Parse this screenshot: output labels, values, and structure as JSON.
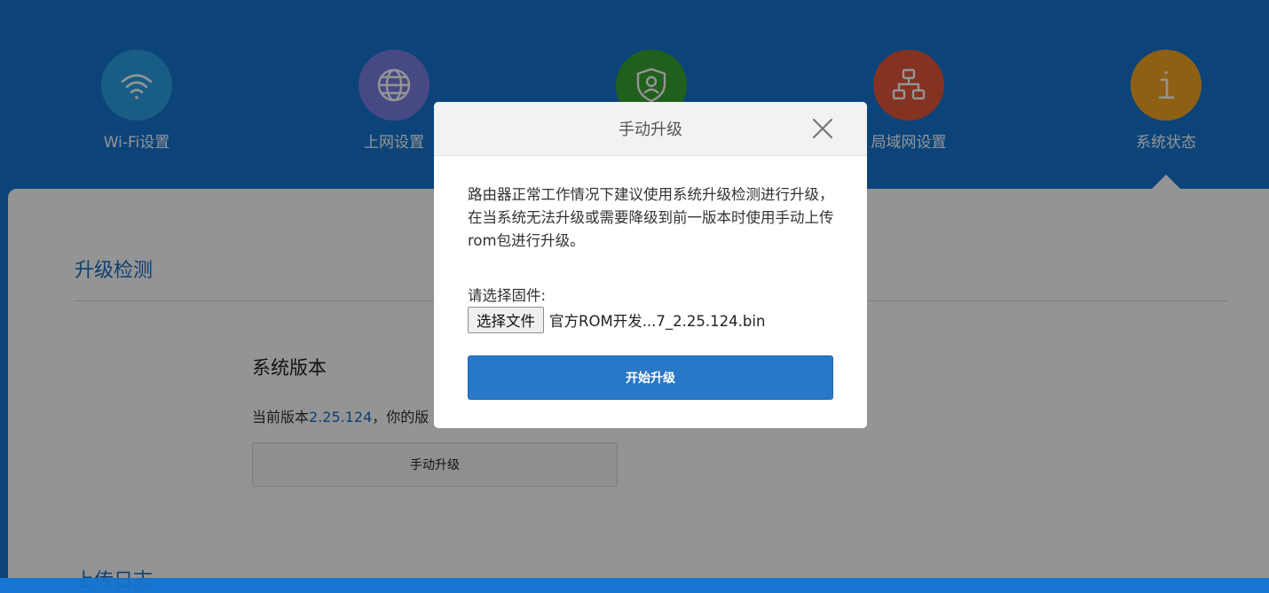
{
  "colors": {
    "header_bg": "#1676d2",
    "wifi": "#2aa3e3",
    "network": "#7b7fe6",
    "security": "#3aa531",
    "lan": "#e3573a",
    "status": "#f5a623",
    "accent": "#1a6fbf",
    "primary_button": "#2878c8"
  },
  "nav": {
    "items": [
      {
        "label": "Wi-Fi设置",
        "icon": "wifi-icon"
      },
      {
        "label": "上网设置",
        "icon": "globe-icon"
      },
      {
        "label": "",
        "icon": "shield-user-icon"
      },
      {
        "label": "局域网设置",
        "icon": "network-tree-icon"
      },
      {
        "label": "系统状态",
        "icon": "info-icon"
      }
    ]
  },
  "main": {
    "section_title": "升级检测",
    "system_version_title": "系统版本",
    "version_prefix": "当前版本",
    "version": "2.25.124",
    "version_suffix": "，你的版",
    "manual_upgrade_button": "手动升级",
    "next_section_title": "上传日志"
  },
  "modal": {
    "title": "手动升级",
    "description": "路由器正常工作情况下建议使用系统升级检测进行升级，在当系统无法升级或需要降级到前一版本时使用手动上传rom包进行升级。",
    "choose_label": "请选择固件:",
    "file_button": "选择文件",
    "file_name": "官方ROM开发...7_2.25.124.bin",
    "start_button": "开始升级"
  }
}
